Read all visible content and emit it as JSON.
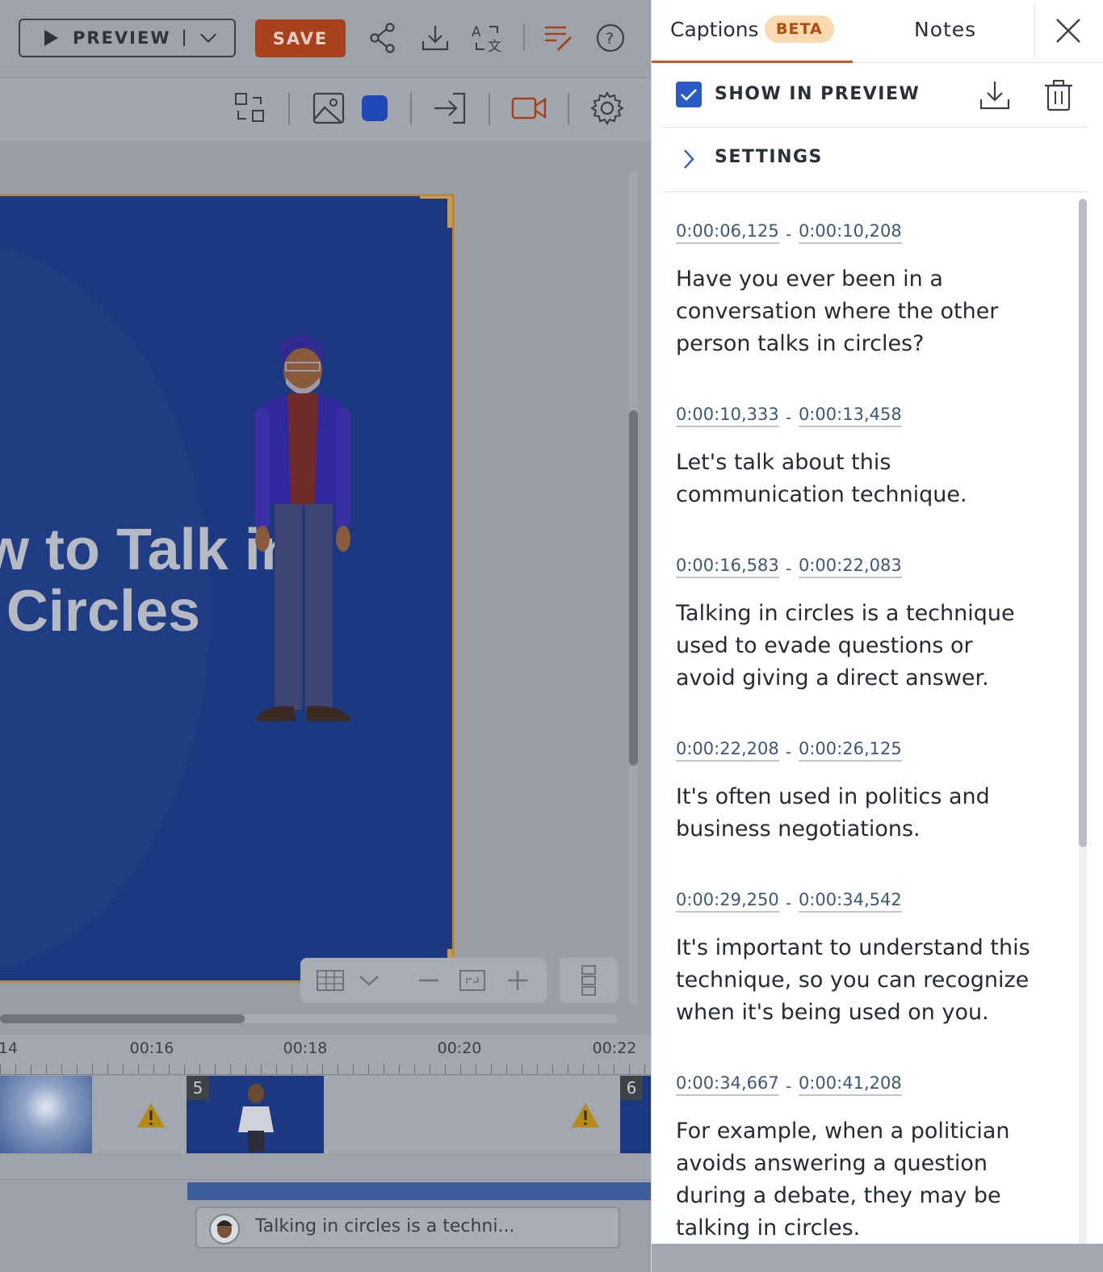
{
  "toolbar": {
    "preview_label": "PREVIEW",
    "save_label": "SAVE",
    "share_icon": "share-icon",
    "download_icon": "download-icon",
    "translate_icon": "translate-icon",
    "notes_edit_icon": "edit-notes-icon",
    "help_icon": "help-icon"
  },
  "secondary_toolbar": {
    "icons": [
      "swap-layout-icon",
      "image-icon",
      "color-swatch-icon",
      "enter-icon",
      "camera-icon",
      "gear-icon"
    ],
    "swatch_color": "#1f49b8"
  },
  "slide": {
    "title_line1": "w to Talk in",
    "title_line2": "Circles",
    "background_color": "#1b3881"
  },
  "timeline": {
    "ticks": [
      "14",
      "00:16",
      "00:18",
      "00:20",
      "00:22"
    ],
    "clips": [
      {
        "number": "5"
      },
      {
        "number": "6"
      }
    ],
    "voice_text": "Talking in circles is a techni..."
  },
  "panel": {
    "tabs": {
      "captions_label": "Captions",
      "beta_badge": "BETA",
      "notes_label": "Notes"
    },
    "show_in_preview_label": "SHOW IN PREVIEW",
    "show_in_preview_checked": true,
    "settings_label": "SETTINGS",
    "captions": [
      {
        "start": "0:00:06,125",
        "end": "0:00:10,208",
        "text": "Have you ever been in a conversation where the other person talks in circles?"
      },
      {
        "start": "0:00:10,333",
        "end": "0:00:13,458",
        "text": "Let's talk about this communication technique."
      },
      {
        "start": "0:00:16,583",
        "end": "0:00:22,083",
        "text": "Talking in circles is a technique used to evade questions or avoid giving a direct answer."
      },
      {
        "start": "0:00:22,208",
        "end": "0:00:26,125",
        "text": "It's often used in politics and business negotiations."
      },
      {
        "start": "0:00:29,250",
        "end": "0:00:34,542",
        "text": "It's important to understand this technique, so you can recognize when it's being used on you."
      },
      {
        "start": "0:00:34,667",
        "end": "0:00:41,208",
        "text": "For example, when a politician avoids answering a question during a debate, they may be talking in circles."
      }
    ],
    "accent_color": "#c9562c",
    "check_color": "#2a5bc7"
  }
}
